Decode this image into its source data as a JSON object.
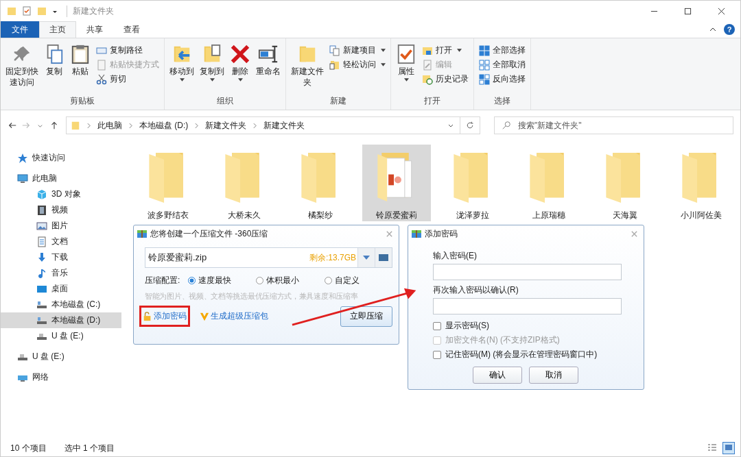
{
  "window": {
    "title": "新建文件夹"
  },
  "tabs": [
    {
      "label": "文件",
      "kind": "file",
      "selected": false
    },
    {
      "label": "主页",
      "kind": "tab",
      "selected": true
    },
    {
      "label": "共享",
      "kind": "tab",
      "selected": false
    },
    {
      "label": "查看",
      "kind": "tab",
      "selected": false
    }
  ],
  "help": "?",
  "ribbon": {
    "groups": [
      {
        "label": "剪贴板",
        "items": [
          {
            "label": "固定到快速访问",
            "kind": "large",
            "disabled": false,
            "dropdown": false
          },
          {
            "label": "复制",
            "kind": "large",
            "disabled": false,
            "dropdown": false
          },
          {
            "label": "粘贴",
            "kind": "large",
            "disabled": false,
            "dropdown": false
          },
          {
            "label": "复制路径",
            "kind": "small",
            "disabled": false,
            "dropdown": false
          },
          {
            "label": "粘贴快捷方式",
            "kind": "small",
            "disabled": true,
            "dropdown": false
          },
          {
            "label": "剪切",
            "kind": "small",
            "disabled": false,
            "dropdown": false
          }
        ]
      },
      {
        "label": "组织",
        "items": [
          {
            "label": "移动到",
            "kind": "large",
            "disabled": false,
            "dropdown": true
          },
          {
            "label": "复制到",
            "kind": "large",
            "disabled": false,
            "dropdown": true
          },
          {
            "label": "删除",
            "kind": "large",
            "disabled": false,
            "dropdown": true
          },
          {
            "label": "重命名",
            "kind": "large",
            "disabled": false,
            "dropdown": false
          }
        ]
      },
      {
        "label": "新建",
        "items": [
          {
            "label": "新建文件夹",
            "kind": "large",
            "disabled": false,
            "dropdown": false
          },
          {
            "label": "新建项目",
            "kind": "small",
            "disabled": false,
            "dropdown": true
          },
          {
            "label": "轻松访问",
            "kind": "small",
            "disabled": false,
            "dropdown": true
          }
        ]
      },
      {
        "label": "打开",
        "items": [
          {
            "label": "属性",
            "kind": "large",
            "disabled": false,
            "dropdown": true
          },
          {
            "label": "打开",
            "kind": "small",
            "disabled": false,
            "dropdown": true
          },
          {
            "label": "编辑",
            "kind": "small",
            "disabled": true,
            "dropdown": false
          },
          {
            "label": "历史记录",
            "kind": "small",
            "disabled": false,
            "dropdown": false
          }
        ]
      },
      {
        "label": "选择",
        "items": [
          {
            "label": "全部选择",
            "kind": "small",
            "disabled": false,
            "dropdown": false
          },
          {
            "label": "全部取消",
            "kind": "small",
            "disabled": false,
            "dropdown": false
          },
          {
            "label": "反向选择",
            "kind": "small",
            "disabled": false,
            "dropdown": false
          }
        ]
      }
    ]
  },
  "address": {
    "path": [
      "此电脑",
      "本地磁盘 (D:)",
      "新建文件夹",
      "新建文件夹"
    ],
    "search_placeholder": "搜索\"新建文件夹\""
  },
  "sidebar": {
    "items": [
      {
        "label": "快速访问",
        "selected": false
      },
      {
        "label": "此电脑",
        "selected": false,
        "children": [
          {
            "label": "3D 对象",
            "selected": false
          },
          {
            "label": "视频",
            "selected": false
          },
          {
            "label": "图片",
            "selected": false
          },
          {
            "label": "文档",
            "selected": false
          },
          {
            "label": "下载",
            "selected": false
          },
          {
            "label": "音乐",
            "selected": false
          },
          {
            "label": "桌面",
            "selected": false
          },
          {
            "label": "本地磁盘 (C:)",
            "selected": false
          },
          {
            "label": "本地磁盘 (D:)",
            "selected": true
          },
          {
            "label": "U 盘 (E:)",
            "selected": false
          }
        ]
      },
      {
        "label": "U 盘 (E:)",
        "selected": false
      },
      {
        "label": "网络",
        "selected": false
      }
    ]
  },
  "files": [
    {
      "name": "波多野结衣",
      "kind": "folder",
      "selected": false
    },
    {
      "name": "大桥未久",
      "kind": "folder",
      "selected": false
    },
    {
      "name": "橘梨纱",
      "kind": "folder",
      "selected": false
    },
    {
      "name": "铃原爱蜜莉",
      "kind": "folder-with-files",
      "selected": true
    },
    {
      "name": "泷泽萝拉",
      "kind": "folder",
      "selected": false
    },
    {
      "name": "上原瑞穗",
      "kind": "folder",
      "selected": false
    },
    {
      "name": "天海翼",
      "kind": "folder",
      "selected": false
    },
    {
      "name": "小川阿佐美",
      "kind": "folder",
      "selected": false
    }
  ],
  "compress_dialog": {
    "title": "您将创建一个压缩文件 -360压缩",
    "filename": "铃原爱蜜莉.zip",
    "free_space": "剩余:13.7GB",
    "config_label": "压缩配置:",
    "options": [
      {
        "label": "速度最快",
        "selected": true
      },
      {
        "label": "体积最小",
        "selected": false
      },
      {
        "label": "自定义",
        "selected": false
      }
    ],
    "hint": "智能为图片、视频、文档等挑选最优压缩方式，兼具速度和压缩率",
    "add_password": "添加密码",
    "super_pack": "生成超级压缩包",
    "compress_button": "立即压缩",
    "highlighted": true
  },
  "password_dialog": {
    "title": "添加密码",
    "fields": [
      {
        "label": "输入密码(E)"
      },
      {
        "label": "再次输入密码以确认(R)"
      }
    ],
    "options": [
      {
        "label": "显示密码(S)",
        "checked": false,
        "disabled": false
      },
      {
        "label": "加密文件名(N) (不支持ZIP格式)",
        "checked": false,
        "disabled": true
      },
      {
        "label": "记住密码(M) (将会显示在管理密码窗口中)",
        "checked": false,
        "disabled": false
      }
    ],
    "buttons": [
      "确认",
      "取消"
    ]
  },
  "status_bar": {
    "count": "10 个项目",
    "selection": "选中 1 个项目",
    "views": [
      {
        "selected": false
      },
      {
        "selected": true
      }
    ]
  }
}
